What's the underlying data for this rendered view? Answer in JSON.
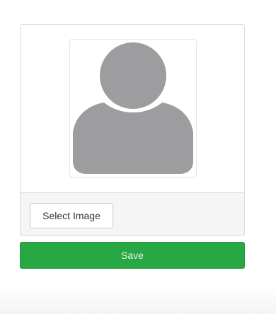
{
  "avatar": {
    "icon": "user-silhouette-icon",
    "color": "#9d9c9f"
  },
  "actions": {
    "select_image_label": "Select Image",
    "save_label": "Save"
  },
  "colors": {
    "save_button": "#28a745",
    "footer_background": "#f5f5f5"
  }
}
